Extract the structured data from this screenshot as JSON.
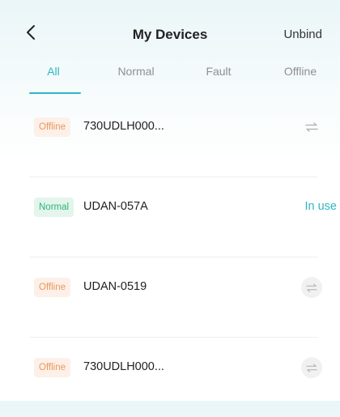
{
  "header": {
    "title": "My Devices",
    "unbind_label": "Unbind"
  },
  "tabs": [
    {
      "label": "All",
      "active": true
    },
    {
      "label": "Normal",
      "active": false
    },
    {
      "label": "Fault",
      "active": false
    },
    {
      "label": "Offline",
      "active": false
    }
  ],
  "devices": [
    {
      "status": "Offline",
      "name": "730UDLH000...",
      "action": "switch-icon"
    },
    {
      "status": "Normal",
      "name": "UDAN-057A",
      "action": "In use"
    },
    {
      "status": "Offline",
      "name": "UDAN-0519",
      "action": "switch-icon"
    },
    {
      "status": "Offline",
      "name": "730UDLH000...",
      "action": "switch-icon"
    }
  ],
  "colors": {
    "accent": "#2fb6c4",
    "offline_text": "#e7995d",
    "offline_bg": "#fdf0e8",
    "normal_text": "#2eb57a",
    "normal_bg": "#e3f5ec"
  }
}
